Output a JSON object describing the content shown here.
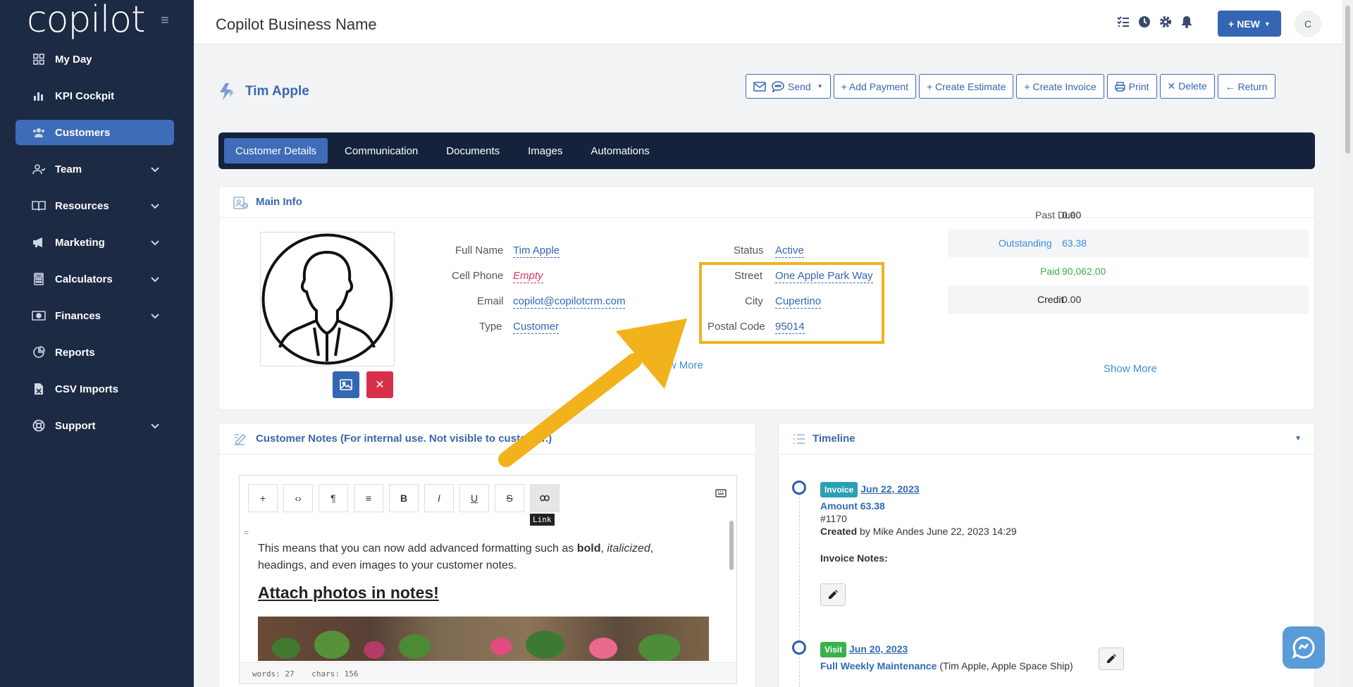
{
  "app": {
    "logo": "copilot",
    "business_name": "Copilot Business Name",
    "new_label": "+ NEW",
    "avatar_initial": "C"
  },
  "sidebar": {
    "items": [
      {
        "label": "My Day",
        "icon": "grid-icon"
      },
      {
        "label": "KPI Cockpit",
        "icon": "bar-chart-icon"
      },
      {
        "label": "Customers",
        "icon": "users-icon",
        "active": true
      },
      {
        "label": "Team",
        "icon": "team-icon",
        "expandable": true
      },
      {
        "label": "Resources",
        "icon": "book-icon",
        "expandable": true
      },
      {
        "label": "Marketing",
        "icon": "megaphone-icon",
        "expandable": true
      },
      {
        "label": "Calculators",
        "icon": "calculator-icon",
        "expandable": true
      },
      {
        "label": "Finances",
        "icon": "money-icon",
        "expandable": true
      },
      {
        "label": "Reports",
        "icon": "pie-chart-icon"
      },
      {
        "label": "CSV Imports",
        "icon": "csv-file-icon"
      },
      {
        "label": "Support",
        "icon": "lifebuoy-icon",
        "expandable": true
      }
    ]
  },
  "customer": {
    "name": "Tim Apple"
  },
  "actions": {
    "send": "Send",
    "add_payment": "+ Add Payment",
    "create_estimate": "+ Create Estimate",
    "create_invoice": "+ Create Invoice",
    "print": "Print",
    "delete": "✕ Delete",
    "return": "← Return"
  },
  "tabs": [
    "Customer Details",
    "Communication",
    "Documents",
    "Images",
    "Automations"
  ],
  "main_info": {
    "title": "Main Info",
    "left_fields": [
      {
        "label": "Full Name",
        "value": "Tim Apple"
      },
      {
        "label": "Cell Phone",
        "value": "Empty"
      },
      {
        "label": "Email",
        "value": "copilot@copilotcrm.com"
      },
      {
        "label": "Type",
        "value": "Customer"
      }
    ],
    "right_fields": [
      {
        "label": "Status",
        "value": "Active"
      },
      {
        "label": "Street",
        "value": "One Apple Park Way"
      },
      {
        "label": "City",
        "value": "Cupertino"
      },
      {
        "label": "Postal Code",
        "value": "95014"
      }
    ],
    "show_more": "Show More",
    "financials": [
      {
        "label": "Past Due",
        "value": "0.00",
        "color": "#333333"
      },
      {
        "label": "Outstanding",
        "value": "63.38",
        "color": "#3b8edb"
      },
      {
        "label": "Paid",
        "value": "90,062.00",
        "color": "#37b24d"
      },
      {
        "label": "Credit",
        "value": "0.00",
        "color": "#333333"
      }
    ]
  },
  "notes": {
    "title": "Customer Notes (For internal use. Not visible to customer.)",
    "tooltip": "Link",
    "paragraph_start": "This means that you can now add advanced formatting such as ",
    "bold": "bold",
    "comma": ", ",
    "italic": "italicized",
    "paragraph_end": ", headings, and even images to your customer notes.",
    "heading": "Attach photos in notes!",
    "word_count": "words: 27",
    "char_count": "chars: 156"
  },
  "timeline": {
    "title": "Timeline",
    "entries": [
      {
        "badge": "Invoice",
        "badge_color": "#2aa0b5",
        "date": "Jun 22, 2023",
        "amount": "Amount 63.38",
        "number": "#1170",
        "created_label": "Created",
        "created_text": " by Mike Andes June 22, 2023 14:29",
        "notes_label": "Invoice Notes:"
      },
      {
        "badge": "Visit",
        "badge_color": "#37b24d",
        "date": "Jun 20, 2023",
        "service": "Full Weekly Maintenance",
        "service_detail": " (Tim Apple, Apple Space Ship)"
      }
    ]
  },
  "colors": {
    "sidebar": "#1d2a44",
    "accent": "#3f6cb8",
    "highlight": "#f2b21b",
    "tab_bar": "#15223b"
  }
}
